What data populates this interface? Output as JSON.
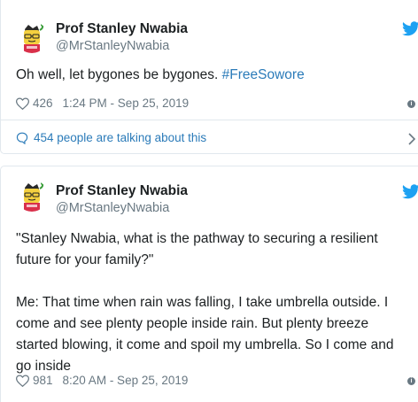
{
  "colors": {
    "link": "#2b7bb9",
    "text": "#1c2022",
    "secondary": "#697882",
    "border": "#e1e8ed",
    "twitter_blue": "#1da1f2"
  },
  "tweets": [
    {
      "author": {
        "name": "Prof Stanley Nwabia",
        "handle": "@MrStanleyNwabia"
      },
      "text": "Oh well, let bygones be bygones. ",
      "hashtag": "#FreeSowore",
      "likes": "426",
      "timestamp": "1:24 PM - Sep 25, 2019",
      "info_icon": "i",
      "talking": "454 people are talking about this"
    },
    {
      "author": {
        "name": "Prof Stanley Nwabia",
        "handle": "@MrStanleyNwabia"
      },
      "text": "\"Stanley Nwabia, what is the pathway to securing a resilient future for your family?\"\n\nMe: That time when rain was falling, I take umbrella outside. I come and see plenty people inside rain. But plenty breeze started blowing, it come and spoil my umbrella. So I come and go inside",
      "likes": "981",
      "timestamp": "8:20 AM - Sep 25, 2019",
      "info_icon": "i"
    }
  ],
  "icons": [
    "avatar",
    "twitter-bird-icon",
    "heart-icon",
    "info-icon",
    "comment-bubble-icon",
    "chevron-right-icon"
  ]
}
